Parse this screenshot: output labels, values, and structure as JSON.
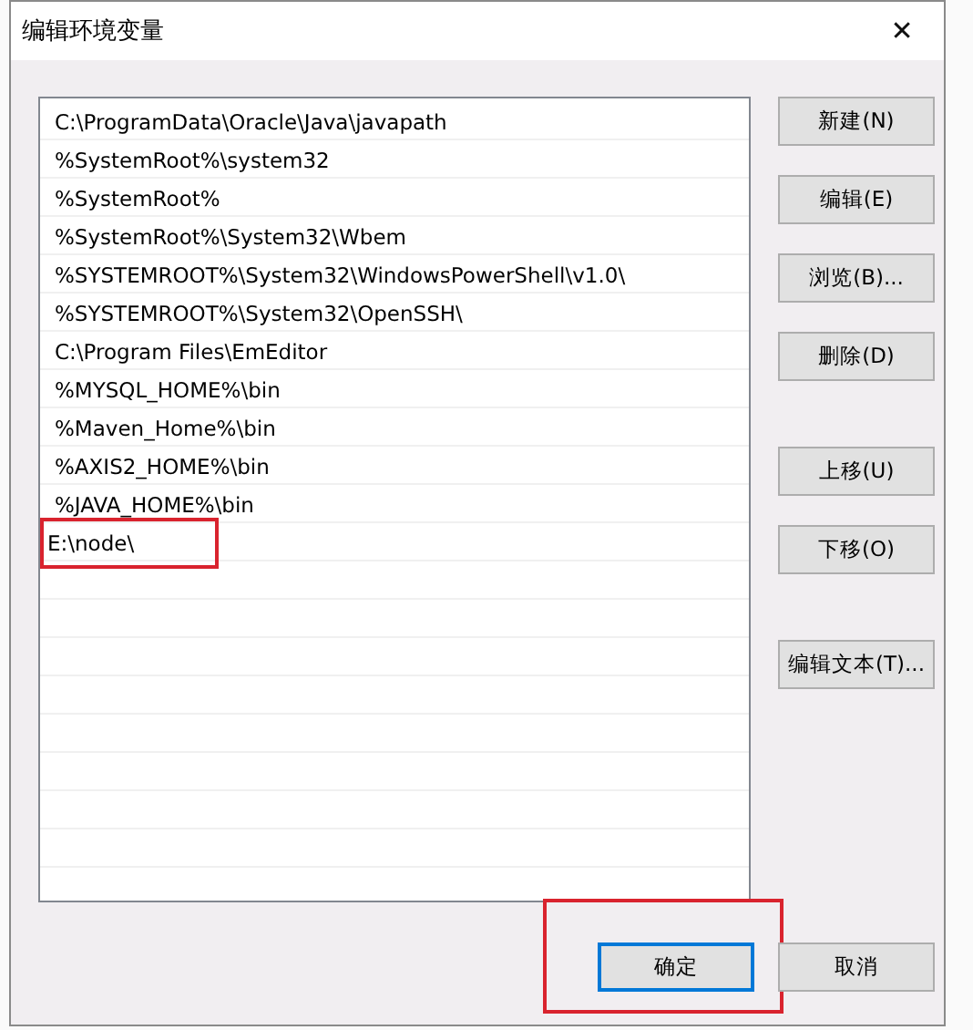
{
  "window": {
    "title": "编辑环境变量",
    "close": "✕"
  },
  "paths": [
    {
      "text": "C:\\ProgramData\\Oracle\\Java\\javapath",
      "annotated": false
    },
    {
      "text": "%SystemRoot%\\system32",
      "annotated": false
    },
    {
      "text": "%SystemRoot%",
      "annotated": false
    },
    {
      "text": "%SystemRoot%\\System32\\Wbem",
      "annotated": false
    },
    {
      "text": "%SYSTEMROOT%\\System32\\WindowsPowerShell\\v1.0\\",
      "annotated": false
    },
    {
      "text": "%SYSTEMROOT%\\System32\\OpenSSH\\",
      "annotated": false
    },
    {
      "text": "C:\\Program Files\\EmEditor",
      "annotated": false
    },
    {
      "text": "%MYSQL_HOME%\\bin",
      "annotated": false
    },
    {
      "text": "%Maven_Home%\\bin",
      "annotated": false
    },
    {
      "text": "%AXIS2_HOME%\\bin",
      "annotated": false
    },
    {
      "text": "%JAVA_HOME%\\bin",
      "annotated": false
    },
    {
      "text": "E:\\node\\",
      "annotated": true
    }
  ],
  "side_button_groups": [
    [
      "新建(N)",
      "编辑(E)",
      "浏览(B)...",
      "删除(D)"
    ],
    [
      "上移(U)",
      "下移(O)"
    ],
    [
      "编辑文本(T)..."
    ]
  ],
  "footer_buttons": [
    {
      "label": "确定",
      "default": true,
      "annotated": true
    },
    {
      "label": "取消",
      "default": false,
      "annotated": false
    }
  ]
}
